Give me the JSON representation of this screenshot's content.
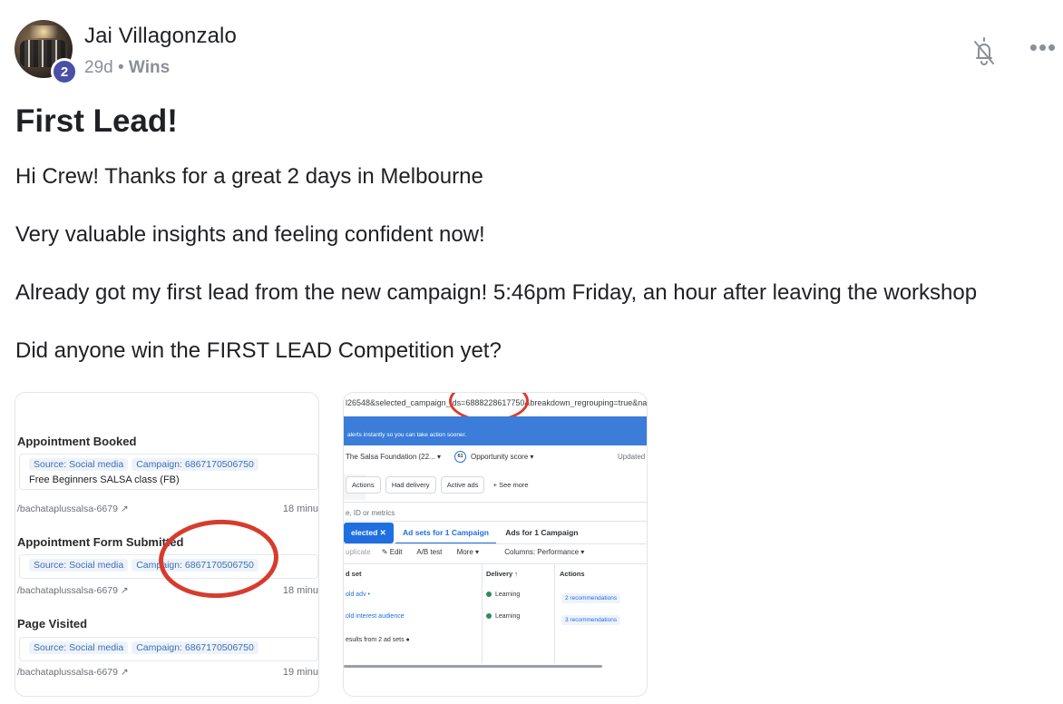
{
  "post": {
    "author": {
      "name": "Jai Villagonzalo",
      "level": "2"
    },
    "time_ago": "29d",
    "separator": "•",
    "category": "Wins",
    "title": "First Lead!",
    "paragraphs": [
      "Hi Crew! Thanks for a great 2 days in Melbourne",
      "Very valuable insights and feeling confident now!",
      "Already got my first lead from the new campaign! 5:46pm Friday, an hour after leaving the workshop",
      "Did anyone win the FIRST LEAD Competition yet?"
    ]
  },
  "actions": {
    "notify_icon": "bell-off-icon",
    "more_icon": "ellipsis-icon",
    "more_label": "•••"
  },
  "attachment1": {
    "events": [
      {
        "title": "Appointment Booked",
        "source": "Source: Social media",
        "campaign": "Campaign: 6867170506750",
        "note": "Free Beginners SALSA class (FB)",
        "link": "/bachataplussalsa-6679 ↗",
        "time": "18 minu"
      },
      {
        "title": "Appointment Form Submitted",
        "source": "Source: Social media",
        "campaign": "Campaign: 6867170506750",
        "link": "/bachataplussalsa-6679 ↗",
        "time": "18 minu"
      },
      {
        "title": "Page Visited",
        "source": "Source: Social media",
        "campaign": "Campaign: 6867170506750",
        "link": "/bachataplussalsa-6679 ↗",
        "time": "19 minu"
      }
    ]
  },
  "attachment2": {
    "url": "l26548&selected_campaign_ids=6888228617750&breakdown_regrouping=true&nav_sou",
    "banner": "alerts instantly so you can take action sooner.",
    "account": "The Salsa Foundation (22... ▾",
    "score": "61",
    "score_label": "Opportunity score ▾",
    "updated": "Updated j",
    "filters": [
      "Actions",
      "Had delivery",
      "Active ads"
    ],
    "see_more": "+  See more",
    "search": "e, ID or metrics",
    "tabs": {
      "selected": "elected ✕",
      "adsets": "Ad sets for 1 Campaign",
      "ads": "Ads for 1 Campaign"
    },
    "toolbar": [
      "uplicate",
      "✎ Edit",
      "A/B test",
      "More ▾",
      "Columns: Performance ▾"
    ],
    "columns": [
      "d set",
      "Delivery ↑",
      "Actions"
    ],
    "rows": [
      {
        "name": "old adv •",
        "delivery": "Learning",
        "rec": "2 recommendations"
      },
      {
        "name": "old interest audience",
        "delivery": "Learning",
        "rec": "3 recommendations"
      }
    ],
    "footer": "esults from 2 ad sets ●"
  }
}
